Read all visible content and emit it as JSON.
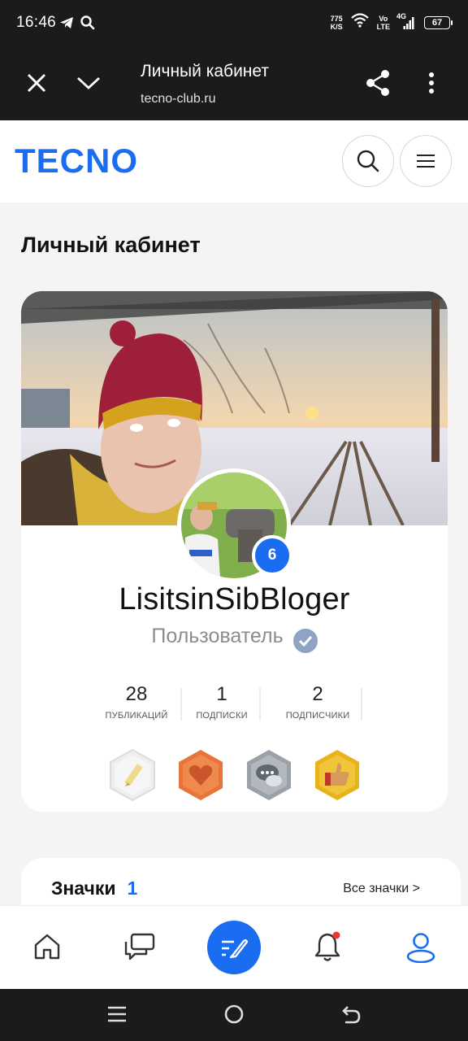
{
  "status_bar": {
    "time": "16:46",
    "net_speed_value": "775",
    "net_speed_unit": "K/S",
    "volte_top": "Vo",
    "volte_bottom": "LTE",
    "network": "4G",
    "battery": "67"
  },
  "browser": {
    "title": "Личный кабинет",
    "url": "tecno-club.ru"
  },
  "site": {
    "logo_text": "TECNO",
    "brand_color": "#1a6df0"
  },
  "page": {
    "title": "Личный кабинет"
  },
  "profile": {
    "username": "LisitsinSibBloger",
    "role": "Пользователь",
    "level": "6",
    "stats": [
      {
        "value": "28",
        "label": "публикаций"
      },
      {
        "value": "1",
        "label": "подписки"
      },
      {
        "value": "2",
        "label": "подписчики"
      }
    ],
    "badges": [
      {
        "icon": "pencil-badge-icon",
        "color": "#e9e9e9"
      },
      {
        "icon": "heart-badge-icon",
        "color": "#e8743b"
      },
      {
        "icon": "chat-badge-icon",
        "color": "#9aa1a9"
      },
      {
        "icon": "thumbs-up-badge-icon",
        "color": "#e7b21a"
      }
    ]
  },
  "badges_section": {
    "title": "Значки",
    "count": "1",
    "all_link": "Все значки  >"
  },
  "bottom_nav": [
    "home-icon",
    "chat-icon",
    "compose-icon",
    "notifications-icon",
    "profile-icon"
  ]
}
